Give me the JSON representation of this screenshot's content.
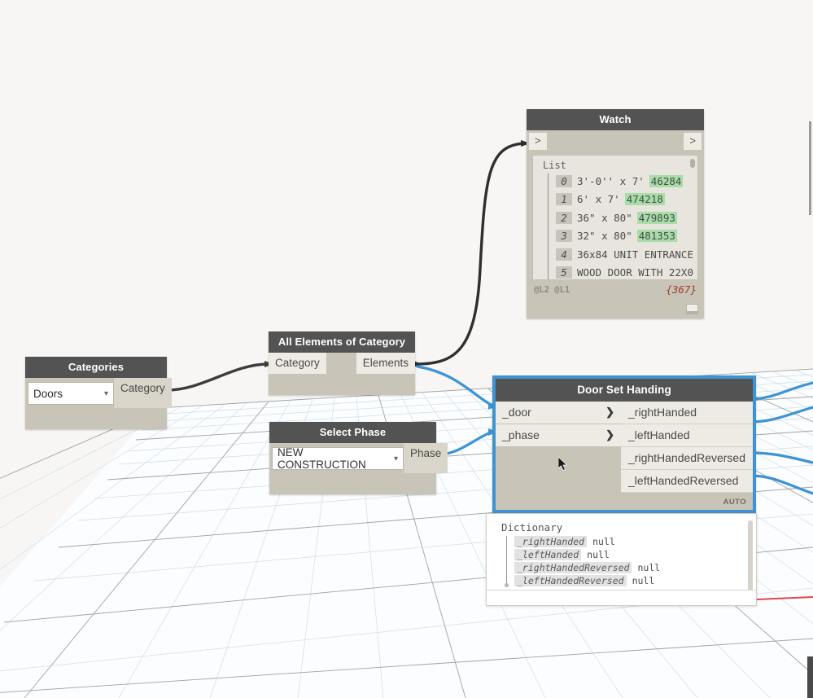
{
  "app": {
    "name": "Dynamo",
    "workspace_background": "#f7f6f4",
    "accent_selected": "#3d93d4",
    "header_color": "#535353",
    "node_body_color": "#c8c4b7",
    "port_color": "#eeeae4",
    "highlight_green": "#a8dda8",
    "count_color": "#a13b2e",
    "axis_red": "#e0484d"
  },
  "nodes": {
    "categories": {
      "title": "Categories",
      "dropdown": {
        "value": "Doors",
        "caret": "chevron-down-icon"
      },
      "outputs": [
        "Category"
      ]
    },
    "all_elements_of_category": {
      "title": "All Elements of Category",
      "inputs": [
        "Category"
      ],
      "outputs": [
        "Elements"
      ]
    },
    "select_phase": {
      "title": "Select Phase",
      "dropdown": {
        "value": "NEW CONSTRUCTION",
        "caret": "chevron-down-icon"
      },
      "outputs": [
        "Phase"
      ]
    },
    "watch": {
      "title": "Watch",
      "port_left_glyph": ">",
      "port_right_glyph": ">",
      "list_label": "List",
      "items": [
        {
          "index": "0",
          "text": "3'-0'' x 7'",
          "number": "46284"
        },
        {
          "index": "1",
          "text": "6' x 7'",
          "number": "474218"
        },
        {
          "index": "2",
          "text": "36\" x 80\"",
          "number": "479893"
        },
        {
          "index": "3",
          "text": "32\" x 80\"",
          "number": "481353"
        },
        {
          "index": "4",
          "text": "36x84 UNIT ENTRANCE",
          "number": ""
        },
        {
          "index": "5",
          "text": "WOOD DOOR WITH 22X0",
          "number": ""
        }
      ],
      "lacing": "@L2 @L1",
      "count": "{367}",
      "resize_handle": "resize-grip-icon"
    },
    "door_set_handing": {
      "title": "Door Set Handing",
      "selected": true,
      "inputs": [
        {
          "label": "_door",
          "arrow": "chevron-right-icon"
        },
        {
          "label": "_phase",
          "arrow": "chevron-right-icon"
        }
      ],
      "outputs": [
        "_rightHanded",
        "_leftHanded",
        "_rightHandedReversed",
        "_leftHandedReversed"
      ],
      "run_mode": "AUTO"
    }
  },
  "dictionary_preview": {
    "title": "Dictionary",
    "entries": [
      {
        "key": "_rightHanded",
        "value": "null"
      },
      {
        "key": "_leftHanded",
        "value": "null"
      },
      {
        "key": "_rightHandedReversed",
        "value": "null"
      },
      {
        "key": "_leftHandedReversed",
        "value": "null"
      }
    ]
  },
  "chrome": {
    "right_scrollbar": "vertical-scrollbar",
    "right_dark_bar": "panel-edge",
    "cursor": "mouse-pointer-icon"
  }
}
